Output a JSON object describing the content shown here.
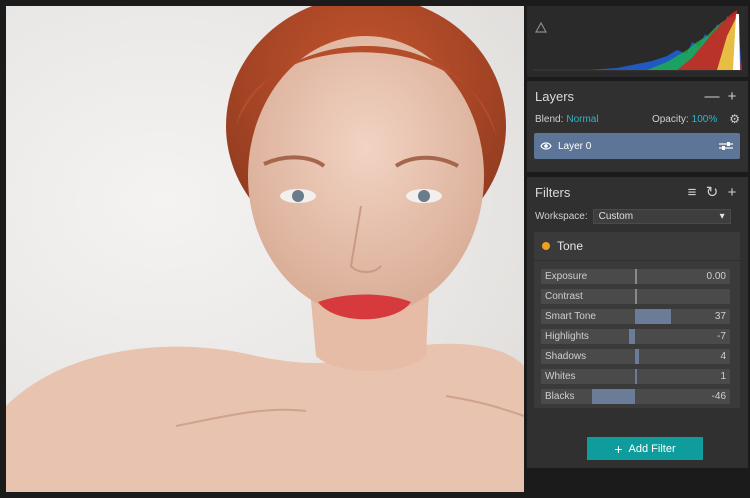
{
  "layers_panel": {
    "title": "Layers",
    "blend_label": "Blend:",
    "blend_value": "Normal",
    "opacity_label": "Opacity:",
    "opacity_value": "100%",
    "items": [
      {
        "name": "Layer 0"
      }
    ]
  },
  "filters_panel": {
    "title": "Filters",
    "workspace_label": "Workspace:",
    "workspace_value": "Custom",
    "group": {
      "name": "Tone",
      "sliders": [
        {
          "label": "Exposure",
          "value": "0.00"
        },
        {
          "label": "Contrast",
          "value": ""
        },
        {
          "label": "Smart Tone",
          "value": "37"
        },
        {
          "label": "Highlights",
          "value": "-7"
        },
        {
          "label": "Shadows",
          "value": "4"
        },
        {
          "label": "Whites",
          "value": "1"
        },
        {
          "label": "Blacks",
          "value": "-46"
        }
      ]
    },
    "add_button_label": "Add Filter"
  },
  "colors": {
    "accent": "#2fb6c8",
    "layer_selected": "#5d7597",
    "button": "#0f9c9c",
    "tone_dot": "#f0a020"
  },
  "icons": [
    "warning-triangle-icon",
    "minus-icon",
    "plus-icon",
    "gear-icon",
    "eye-icon",
    "sliders-icon",
    "add-list-icon",
    "refresh-icon",
    "chevron-down-icon"
  ]
}
